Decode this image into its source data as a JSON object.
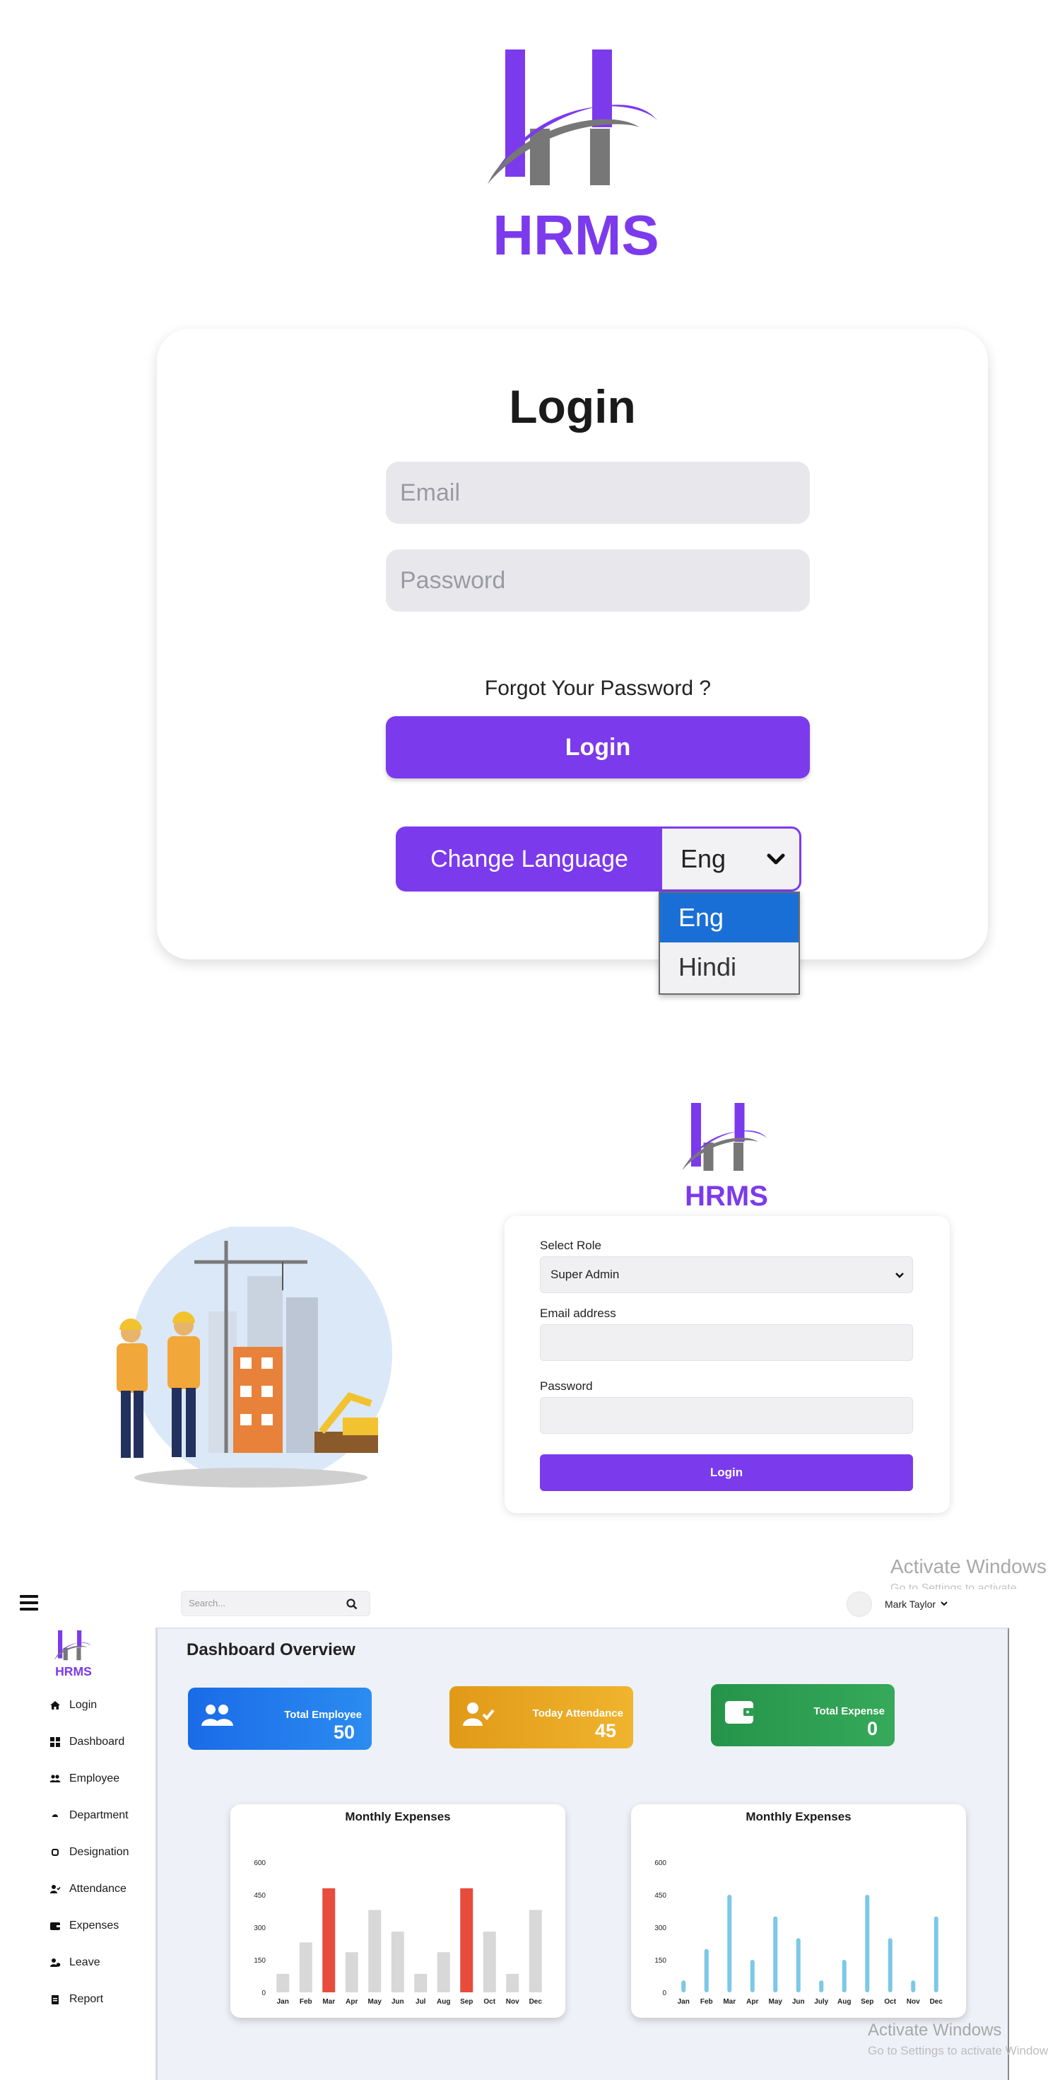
{
  "colors": {
    "accent": "#7c3aed",
    "blue": "#1a73e8",
    "orange": "#e5a51f",
    "green": "#2a9d4f",
    "bar_gray": "#d8d8d8",
    "bar_red": "#e74c3c",
    "bar_blue": "#7cc8e8"
  },
  "brand": {
    "name": "HRMS"
  },
  "login_page": {
    "title": "Login",
    "email_placeholder": "Email",
    "password_placeholder": "Password",
    "forgot_link": "Forgot Your Password ?",
    "login_button": "Login",
    "language_label": "Change Language",
    "language_selected": "Eng",
    "language_options": [
      "Eng",
      "Hindi"
    ]
  },
  "login_form": {
    "role_label": "Select Role",
    "role_selected": "Super Admin",
    "email_label": "Email address",
    "password_label": "Password",
    "login_button": "Login"
  },
  "watermark": {
    "top_title": "Activate Windows",
    "top_sub": "Go to Settings to activate Windows",
    "bottom_title": "Activate Windows",
    "bottom_sub": "Go to Settings to activate Window"
  },
  "dashboard": {
    "search_placeholder": "Search...",
    "user_name": "Mark Taylor",
    "title": "Dashboard Overview",
    "nav_items": [
      {
        "label": "Login",
        "icon": "home-icon"
      },
      {
        "label": "Dashboard",
        "icon": "grid-icon"
      },
      {
        "label": "Employee",
        "icon": "users-icon"
      },
      {
        "label": "Department",
        "icon": "building-icon"
      },
      {
        "label": "Designation",
        "icon": "badge-icon"
      },
      {
        "label": "Attendance",
        "icon": "user-check-icon"
      },
      {
        "label": "Expenses",
        "icon": "wallet-icon"
      },
      {
        "label": "Leave",
        "icon": "user-clock-icon"
      },
      {
        "label": "Report",
        "icon": "clipboard-icon"
      }
    ],
    "stats": [
      {
        "label": "Total Employee",
        "value": "50",
        "icon": "users-icon"
      },
      {
        "label": "Today Attendance",
        "value": "45",
        "icon": "user-check-icon"
      },
      {
        "label": "Total Expense",
        "value": "0",
        "icon": "wallet-icon"
      }
    ]
  },
  "chart_data": [
    {
      "type": "bar",
      "title": "Monthly Expenses",
      "categories": [
        "Jan",
        "Feb",
        "Mar",
        "Apr",
        "May",
        "Jun",
        "Jul",
        "Aug",
        "Sep",
        "Oct",
        "Nov",
        "Dec"
      ],
      "values": [
        85,
        230,
        480,
        185,
        380,
        280,
        85,
        185,
        480,
        280,
        85,
        380
      ],
      "highlight": [
        2,
        8
      ],
      "yticks": [
        0,
        150,
        300,
        450,
        600
      ],
      "ylim": [
        0,
        600
      ],
      "grid": false
    },
    {
      "type": "bar",
      "title": "Monthly Expenses",
      "categories": [
        "Jan",
        "Feb",
        "Mar",
        "Apr",
        "May",
        "Jun",
        "July",
        "Aug",
        "Sep",
        "Oct",
        "Nov",
        "Dec"
      ],
      "values": [
        55,
        200,
        450,
        150,
        350,
        250,
        55,
        150,
        450,
        250,
        55,
        350
      ],
      "yticks": [
        0,
        150,
        300,
        450,
        600
      ],
      "ylim": [
        0,
        600
      ],
      "grid": false
    }
  ]
}
